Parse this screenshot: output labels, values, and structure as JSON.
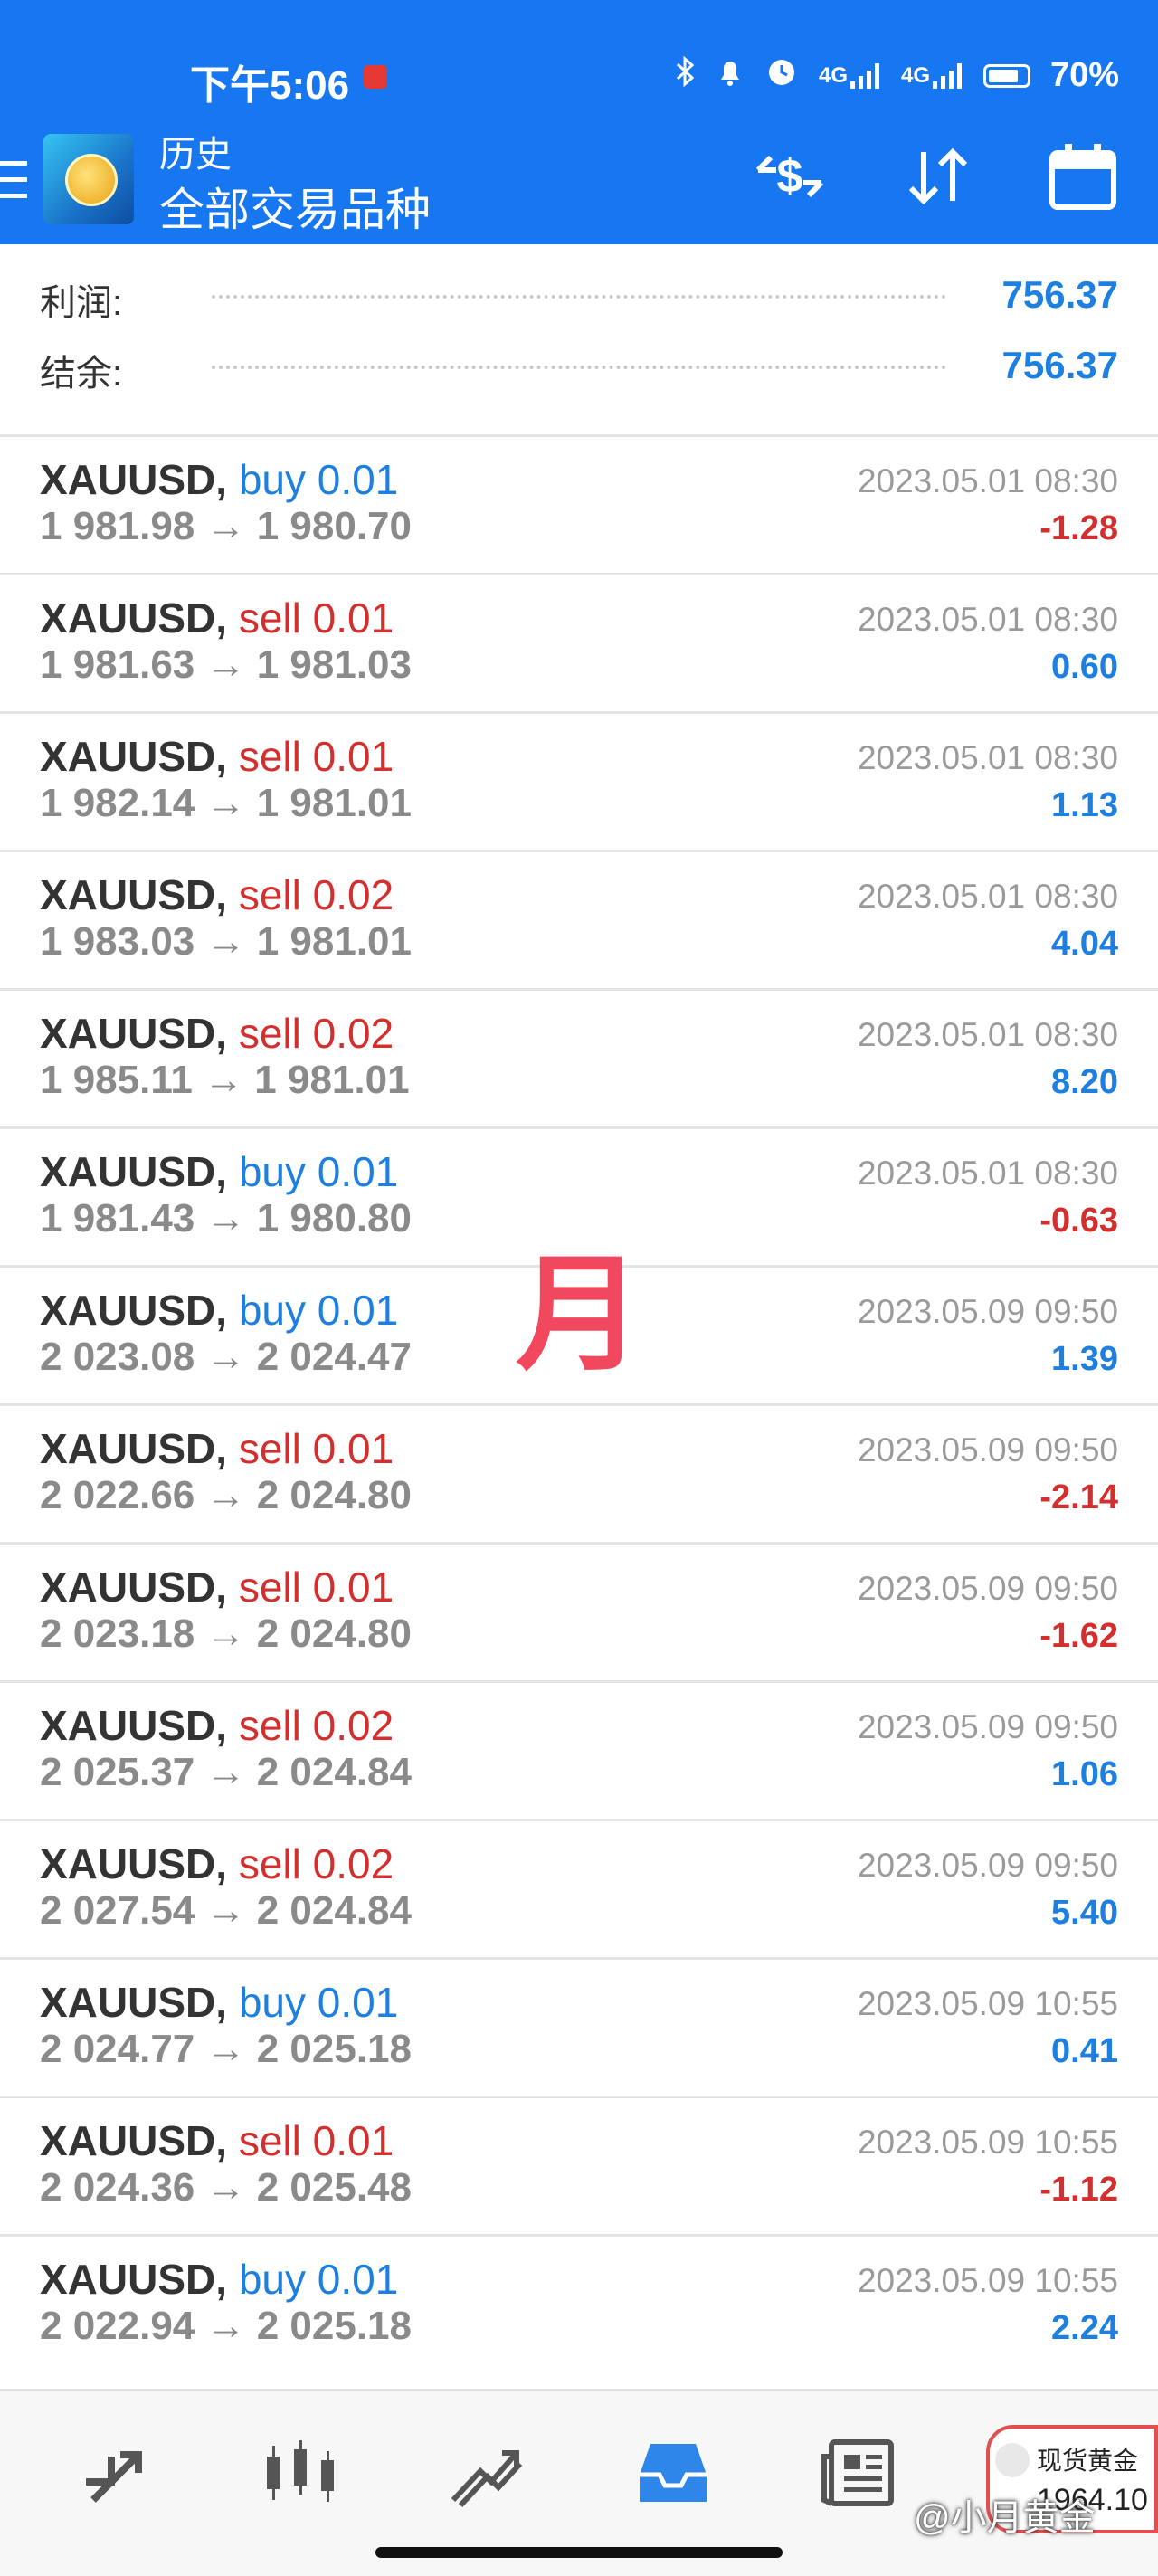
{
  "status_bar": {
    "time": "下午5:06",
    "network1": "4G",
    "network2": "4G",
    "battery": "70%"
  },
  "header": {
    "title": "历史",
    "subtitle": "全部交易品种",
    "icons": [
      "menu-icon",
      "app-logo",
      "currency-exchange-icon",
      "sort-icon",
      "calendar-icon"
    ]
  },
  "summary": {
    "profit_label": "利润:",
    "profit_value": "756.37",
    "balance_label": "结余:",
    "balance_value": "756.37"
  },
  "trades": [
    {
      "symbol": "XAUUSD,",
      "side": "buy",
      "volume": "0.01",
      "prices": "1 981.98 → 1 980.70",
      "time": "2023.05.01 08:30",
      "pl": "-1.28"
    },
    {
      "symbol": "XAUUSD,",
      "side": "sell",
      "volume": "0.01",
      "prices": "1 981.63 → 1 981.03",
      "time": "2023.05.01 08:30",
      "pl": "0.60"
    },
    {
      "symbol": "XAUUSD,",
      "side": "sell",
      "volume": "0.01",
      "prices": "1 982.14 → 1 981.01",
      "time": "2023.05.01 08:30",
      "pl": "1.13"
    },
    {
      "symbol": "XAUUSD,",
      "side": "sell",
      "volume": "0.02",
      "prices": "1 983.03 → 1 981.01",
      "time": "2023.05.01 08:30",
      "pl": "4.04"
    },
    {
      "symbol": "XAUUSD,",
      "side": "sell",
      "volume": "0.02",
      "prices": "1 985.11 → 1 981.01",
      "time": "2023.05.01 08:30",
      "pl": "8.20"
    },
    {
      "symbol": "XAUUSD,",
      "side": "buy",
      "volume": "0.01",
      "prices": "1 981.43 → 1 980.80",
      "time": "2023.05.01 08:30",
      "pl": "-0.63"
    },
    {
      "symbol": "XAUUSD,",
      "side": "buy",
      "volume": "0.01",
      "prices": "2 023.08 → 2 024.47",
      "time": "2023.05.09 09:50",
      "pl": "1.39"
    },
    {
      "symbol": "XAUUSD,",
      "side": "sell",
      "volume": "0.01",
      "prices": "2 022.66 → 2 024.80",
      "time": "2023.05.09 09:50",
      "pl": "-2.14"
    },
    {
      "symbol": "XAUUSD,",
      "side": "sell",
      "volume": "0.01",
      "prices": "2 023.18 → 2 024.80",
      "time": "2023.05.09 09:50",
      "pl": "-1.62"
    },
    {
      "symbol": "XAUUSD,",
      "side": "sell",
      "volume": "0.02",
      "prices": "2 025.37 → 2 024.84",
      "time": "2023.05.09 09:50",
      "pl": "1.06"
    },
    {
      "symbol": "XAUUSD,",
      "side": "sell",
      "volume": "0.02",
      "prices": "2 027.54 → 2 024.84",
      "time": "2023.05.09 09:50",
      "pl": "5.40"
    },
    {
      "symbol": "XAUUSD,",
      "side": "buy",
      "volume": "0.01",
      "prices": "2 024.77 → 2 025.18",
      "time": "2023.05.09 10:55",
      "pl": "0.41"
    },
    {
      "symbol": "XAUUSD,",
      "side": "sell",
      "volume": "0.01",
      "prices": "2 024.36 → 2 025.48",
      "time": "2023.05.09 10:55",
      "pl": "-1.12"
    },
    {
      "symbol": "XAUUSD,",
      "side": "buy",
      "volume": "0.01",
      "prices": "2 022.94 → 2 025.18",
      "time": "2023.05.09 10:55",
      "pl": "2.24"
    }
  ],
  "overlay": {
    "watermark_char": "月",
    "popup_title": "现货黄金",
    "popup_value": "1964.10",
    "credit": "@小月黄金"
  },
  "colors": {
    "header_bg": "#1677f1",
    "positive": "#1d7fe0",
    "negative": "#d32f2f",
    "buy": "#1d7fe0",
    "sell": "#d32f2f"
  },
  "bottom_nav": [
    "quotes-icon",
    "chart-icon",
    "trade-icon",
    "history-icon",
    "news-icon"
  ]
}
